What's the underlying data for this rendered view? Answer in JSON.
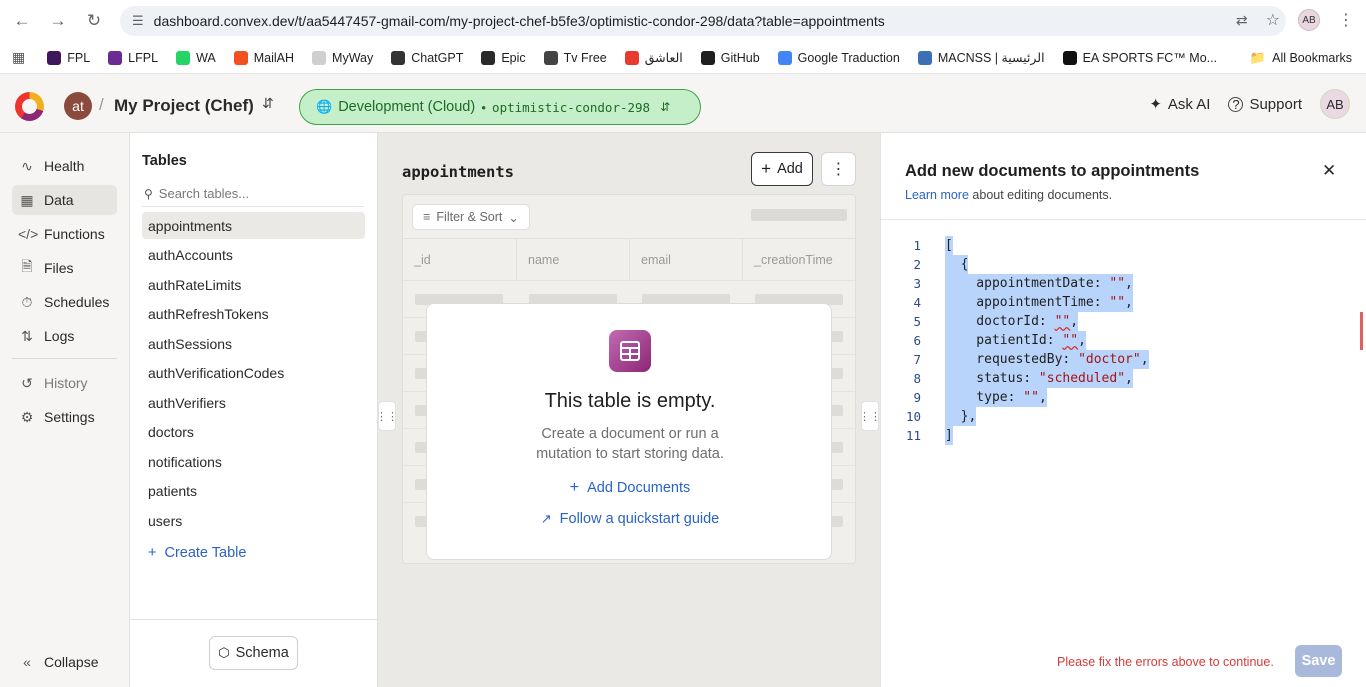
{
  "browser": {
    "url": "dashboard.convex.dev/t/aa5447457-gmail-com/my-project-chef-b5fe3/optimistic-condor-298/data?table=appointments",
    "profile_initials": "AB",
    "bookmarks": [
      {
        "label": "FPL",
        "color": "#3d195b"
      },
      {
        "label": "LFPL",
        "color": "#6b2c91"
      },
      {
        "label": "WA",
        "color": "#25d366"
      },
      {
        "label": "MailAH",
        "color": "#f25022"
      },
      {
        "label": "MyWay",
        "color": "#cfcfcf"
      },
      {
        "label": "ChatGPT",
        "color": "#333333"
      },
      {
        "label": "Epic",
        "color": "#2a2a2a"
      },
      {
        "label": "Tv Free",
        "color": "#444444"
      },
      {
        "label": "العاشق",
        "color": "#e63b2e"
      },
      {
        "label": "GitHub",
        "color": "#1f1f1f"
      },
      {
        "label": "Google Traduction",
        "color": "#4285f4"
      },
      {
        "label": "MACNSS | الرئيسية",
        "color": "#3b6fb6"
      },
      {
        "label": "EA SPORTS FC™ Mo...",
        "color": "#111111"
      }
    ],
    "all_bookmarks": "All Bookmarks"
  },
  "header": {
    "team_initials": "at",
    "project_name": "My Project (Chef)",
    "deployment_label": "Development (Cloud)",
    "deployment_name": "optimistic-condor-298",
    "ask_ai": "Ask AI",
    "support": "Support",
    "user_initials": "AB"
  },
  "nav": {
    "items": [
      {
        "label": "Health"
      },
      {
        "label": "Data"
      },
      {
        "label": "Functions"
      },
      {
        "label": "Files"
      },
      {
        "label": "Schedules"
      },
      {
        "label": "Logs"
      },
      {
        "label": "History"
      },
      {
        "label": "Settings"
      }
    ],
    "collapse": "Collapse"
  },
  "tables_panel": {
    "title": "Tables",
    "search_placeholder": "Search tables...",
    "tables": [
      "appointments",
      "authAccounts",
      "authRateLimits",
      "authRefreshTokens",
      "authSessions",
      "authVerificationCodes",
      "authVerifiers",
      "doctors",
      "notifications",
      "patients",
      "users"
    ],
    "create_table": "Create Table",
    "schema": "Schema"
  },
  "center": {
    "table_name": "appointments",
    "add_label": "Add",
    "filter_sort": "Filter & Sort",
    "columns": [
      "_id",
      "name",
      "email",
      "_creationTime"
    ],
    "empty_title": "This table is empty.",
    "empty_desc": "Create a document or run a mutation to start storing data.",
    "add_documents": "Add Documents",
    "quickstart": "Follow a quickstart guide"
  },
  "right_panel": {
    "title": "Add new documents to appointments",
    "learn_more": "Learn more",
    "learn_more_rest": " about editing documents.",
    "line_numbers": [
      "1",
      "2",
      "3",
      "4",
      "5",
      "6",
      "7",
      "8",
      "9",
      "10",
      "11"
    ],
    "error": "Please fix the errors above to continue.",
    "save": "Save"
  },
  "colors": {
    "accent_blue": "#2b63c5",
    "deploy_green": "#c5efc8",
    "error_red": "#d33b3b",
    "selection_blue": "#b9d4fb"
  }
}
